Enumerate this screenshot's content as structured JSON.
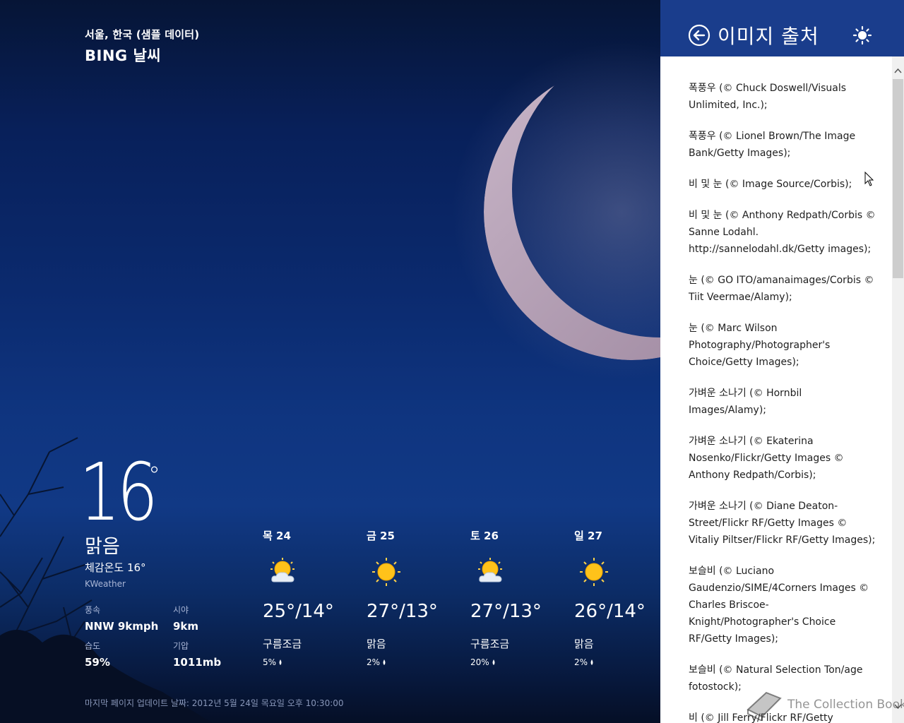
{
  "weather": {
    "location": "서울, 한국 (샘플 데이터)",
    "app_title": "BING 날씨",
    "current": {
      "temp": "16",
      "degree": "°",
      "condition": "맑음",
      "feels_like": "체감온도 16°",
      "provider": "KWeather",
      "wind_label": "풍속",
      "wind_value": "NNW 9kmph",
      "visibility_label": "시야",
      "visibility_value": "9km",
      "humidity_label": "습도",
      "humidity_value": "59%",
      "pressure_label": "기압",
      "pressure_value": "1011mb"
    },
    "forecast": [
      {
        "day": "목 24",
        "icon": "partly-cloudy-icon",
        "temp": "25°/14°",
        "condition": "구름조금",
        "precip": "5%"
      },
      {
        "day": "금 25",
        "icon": "sunny-icon",
        "temp": "27°/13°",
        "condition": "맑음",
        "precip": "2%"
      },
      {
        "day": "토 26",
        "icon": "partly-cloudy-icon",
        "temp": "27°/13°",
        "condition": "구름조금",
        "precip": "20%"
      },
      {
        "day": "일 27",
        "icon": "sunny-icon",
        "temp": "26°/14°",
        "condition": "맑음",
        "precip": "2%"
      }
    ],
    "updated": "마지막 페이지 업데이트 날짜: 2012년 5월 24일 목요일 오후 10:30:00"
  },
  "flyout": {
    "title": "이미지 출처",
    "header_color": "#1a3d8c",
    "credits": [
      "폭풍우 (© Chuck Doswell/Visuals Unlimited, Inc.);",
      "폭풍우 (© Lionel Brown/The Image Bank/Getty Images);",
      "비 및 눈 (© Image Source/Corbis);",
      "비 및 눈 (© Anthony Redpath/Corbis © Sanne Lodahl. http://sannelodahl.dk/Getty images);",
      "눈 (© GO ITO/amanaimages/Corbis © Tiit Veermae/Alamy);",
      "눈 (© Marc Wilson Photography/Photographer's Choice/Getty Images);",
      "가벼운 소나기 (© Hornbil Images/Alamy);",
      "가벼운 소나기 (© Ekaterina Nosenko/Flickr/Getty Images © Anthony Redpath/Corbis);",
      "가벼운 소나기 (© Diane Deaton-Street/Flickr RF/Getty Images © Vitaliy Piltser/Flickr RF/Getty Images);",
      "보슬비 (© Luciano Gaudenzio/SIME/4Corners Images © Charles Briscoe-Knight/Photographer's Choice RF/Getty Images);",
      "보슬비 (© Natural Selection Ton/age fotostock);",
      "비 (© Jill Ferry/Flickr RF/Getty Images);"
    ]
  },
  "watermark": "The Collection Book"
}
